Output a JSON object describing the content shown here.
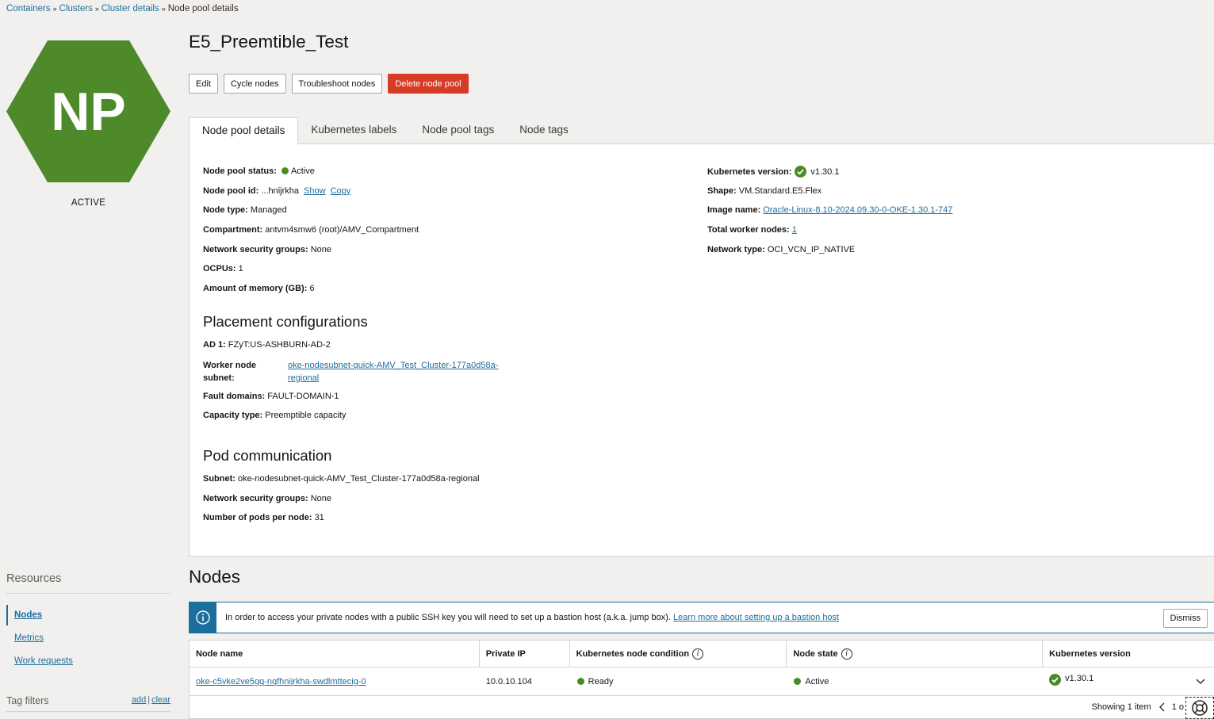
{
  "breadcrumb": [
    "Containers",
    "Clusters",
    "Cluster details",
    "Node pool details"
  ],
  "avatar": {
    "initials": "NP",
    "color": "#4e8a2a",
    "status": "ACTIVE"
  },
  "title": "E5_Preemtible_Test",
  "actions": {
    "edit": "Edit",
    "cycle": "Cycle nodes",
    "troubleshoot": "Troubleshoot nodes",
    "delete": "Delete node pool"
  },
  "tabs": [
    "Node pool details",
    "Kubernetes labels",
    "Node pool tags",
    "Node tags"
  ],
  "details_left": {
    "status_label": "Node pool status:",
    "status_value": "Active",
    "id_label": "Node pool id:",
    "id_value": "...hnijrkha",
    "id_show": "Show",
    "id_copy": "Copy",
    "type_label": "Node type:",
    "type_value": "Managed",
    "compartment_label": "Compartment:",
    "compartment_value": "antvm4smw6 (root)/AMV_Compartment",
    "nsg_label": "Network security groups:",
    "nsg_value": "None",
    "ocpu_label": "OCPUs:",
    "ocpu_value": "1",
    "memory_label": "Amount of memory (GB):",
    "memory_value": "6"
  },
  "details_right": {
    "k8s_label": "Kubernetes version:",
    "k8s_value": "v1.30.1",
    "shape_label": "Shape:",
    "shape_value": "VM.Standard.E5.Flex",
    "image_label": "Image name:",
    "image_value": "Oracle-Linux-8.10-2024.09.30-0-OKE-1.30.1-747",
    "workers_label": "Total worker nodes:",
    "workers_value": "1",
    "network_label": "Network type:",
    "network_value": "OCI_VCN_IP_NATIVE"
  },
  "placement": {
    "heading": "Placement configurations",
    "ad_label": "AD 1:",
    "ad_value": "FZyT:US-ASHBURN-AD-2",
    "subnet_label": "Worker node subnet:",
    "subnet_value": "oke-nodesubnet-quick-AMV_Test_Cluster-177a0d58a-regional",
    "fault_label": "Fault domains:",
    "fault_value": "FAULT-DOMAIN-1",
    "capacity_label": "Capacity type:",
    "capacity_value": "Preemptible capacity"
  },
  "pod": {
    "heading": "Pod communication",
    "subnet_label": "Subnet:",
    "subnet_value": "oke-nodesubnet-quick-AMV_Test_Cluster-177a0d58a-regional",
    "nsg_label": "Network security groups:",
    "nsg_value": "None",
    "pods_label": "Number of pods per node:",
    "pods_value": "31"
  },
  "resources": {
    "title": "Resources",
    "items": [
      "Nodes",
      "Metrics",
      "Work requests"
    ]
  },
  "tag_filters": {
    "title": "Tag filters",
    "add": "add",
    "sep": "|",
    "clear": "clear"
  },
  "nodes": {
    "title": "Nodes",
    "banner_text": "In order to access your private nodes with a public SSH key you will need to set up a bastion host (a.k.a. jump box).",
    "banner_link": "Learn more about setting up a bastion host",
    "dismiss": "Dismiss",
    "columns": [
      "Node name",
      "Private IP",
      "Kubernetes node condition",
      "Node state",
      "Kubernetes version"
    ],
    "rows": [
      {
        "name": "oke-c5vke2ve5gq-nqfhnijrkha-swdlmttecig-0",
        "ip": "10.0.10.104",
        "condition": "Ready",
        "state": "Active",
        "version": "v1.30.1"
      }
    ],
    "showing": "Showing 1 item",
    "page": "1 o"
  },
  "colors": {
    "accent": "#1b6e9e",
    "success": "#498b27",
    "danger": "#d63b25"
  }
}
